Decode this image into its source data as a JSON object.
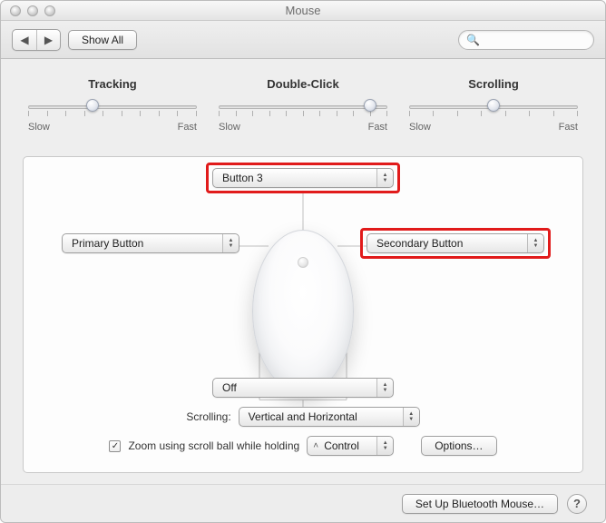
{
  "window": {
    "title": "Mouse"
  },
  "toolbar": {
    "show_all": "Show All",
    "search_placeholder": ""
  },
  "sliders": {
    "tracking": {
      "label": "Tracking",
      "slow": "Slow",
      "fast": "Fast",
      "value_pct": 38
    },
    "dclick": {
      "label": "Double-Click",
      "slow": "Slow",
      "fast": "Fast",
      "value_pct": 90
    },
    "scroll": {
      "label": "Scrolling",
      "slow": "Slow",
      "fast": "Fast",
      "value_pct": 50
    }
  },
  "buttons": {
    "top": "Button 3",
    "left": "Primary Button",
    "right": "Secondary Button",
    "side": "Off"
  },
  "scrolling_label": "Scrolling:",
  "scrolling_value": "Vertical and Horizontal",
  "zoom": {
    "checked": true,
    "label": "Zoom using scroll ball while holding",
    "modifier": "Control",
    "options": "Options…"
  },
  "footer": {
    "setup": "Set Up Bluetooth Mouse…",
    "help": "?"
  }
}
